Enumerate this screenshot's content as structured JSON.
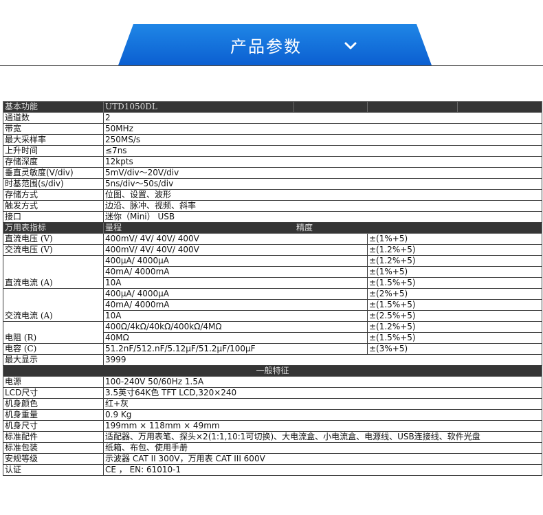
{
  "header": {
    "title": "产品参数",
    "chevron_icon": "chevron-down-icon",
    "bar_color": "#0b6fe0"
  },
  "basic": {
    "header": [
      "基本功能",
      "UTD1050DL"
    ],
    "rows": [
      [
        "通道数",
        "2"
      ],
      [
        "带宽",
        "50MHz"
      ],
      [
        "最大采样率",
        "250MS/s"
      ],
      [
        "上升时间",
        "≤7ns"
      ],
      [
        "存储深度",
        "12kpts"
      ],
      [
        "垂直灵敏度(V/div)",
        "5mV/div～20V/div"
      ],
      [
        "时基范围(s/div)",
        "5ns/div～50s/div"
      ],
      [
        "存储方式",
        "位图、设置、波形"
      ],
      [
        "触发方式",
        "边沿、脉冲、视频、斜率"
      ],
      [
        "接口",
        "迷你（Mini） USB"
      ]
    ]
  },
  "meter": {
    "header": [
      "万用表指标",
      "量程",
      "精度"
    ],
    "dcv": {
      "name": "直流电压 (V)",
      "range": "400mV/ 4V/ 40V/ 400V",
      "acc": "±(1%+5)"
    },
    "acv": {
      "name": "交流电压 (V)",
      "range": "400mV/ 4V/ 40V/ 400V",
      "acc": "±(1.2%+5)"
    },
    "dca": {
      "name": "直流电流 (A)",
      "ranges": [
        "400μA/ 4000μA",
        "40mA/ 4000mA",
        "10A"
      ],
      "accs": [
        "±(1.2%+5)",
        "±(1%+5)",
        "±(1.5%+5)"
      ]
    },
    "aca": {
      "name": "交流电流 (A)",
      "ranges": [
        "400μA/ 4000μA",
        "40mA/ 4000mA",
        "10A"
      ],
      "accs": [
        "±(2%+5)",
        "±(1.5%+5)",
        "±(2.5%+5)"
      ]
    },
    "res": {
      "name": "电阻 (R)",
      "ranges": [
        "400Ω/4kΩ/40kΩ/400kΩ/4MΩ",
        "40MΩ"
      ],
      "accs": [
        "±(1.2%+5)",
        "±(1.5%+5)"
      ]
    },
    "cap": {
      "name": "电容 (C)",
      "range": "51.2nF/512.nF/5.12μF/51.2μF/100μF",
      "acc": "±(3%+5)"
    },
    "maxdisp": {
      "name": "最大显示",
      "value": "3999"
    }
  },
  "general": {
    "header": "一般特征",
    "rows": [
      [
        "电源",
        "100-240V 50/60Hz 1.5A"
      ],
      [
        "LCD尺寸",
        "3.5英寸64K色 TFT LCD,320×240"
      ],
      [
        "机身颜色",
        "红+灰"
      ],
      [
        "机身重量",
        "0.9 Kg"
      ],
      [
        "机身尺寸",
        "199mm × 118mm × 49mm"
      ],
      [
        "标准配件",
        "适配器、万用表笔、探头×2(1:1,10:1可切换)、大电流盒、小电流盒、电源线、USB连接线、软件光盘"
      ],
      [
        "标准包装",
        "纸箱、布包、使用手册"
      ],
      [
        "安规等级",
        "示波器 CAT II 300V，万用表 CAT III 600V"
      ],
      [
        "认证",
        "CE ， EN: 61010-1"
      ]
    ]
  }
}
